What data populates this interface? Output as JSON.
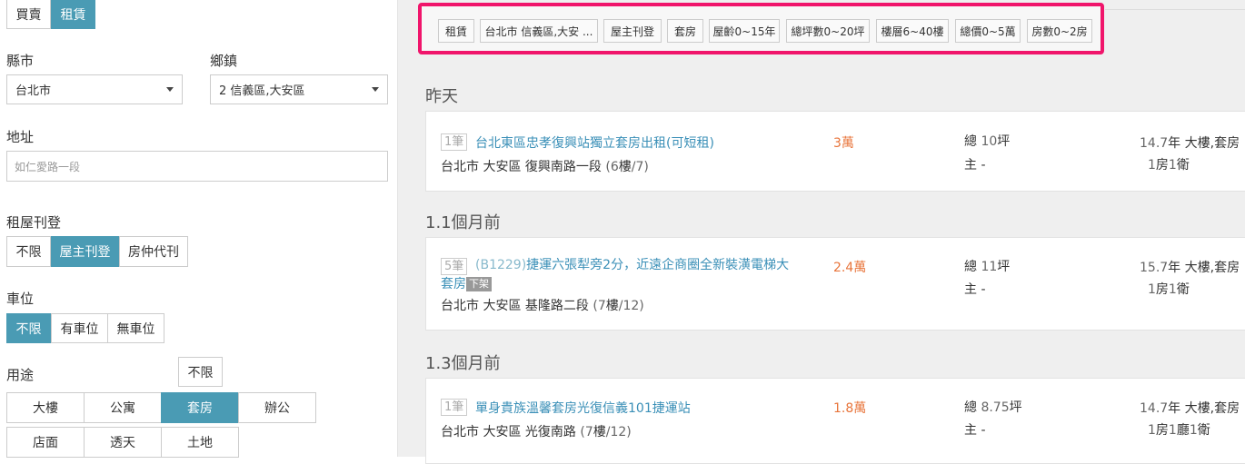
{
  "mode_tabs": [
    "買賣",
    "租賃"
  ],
  "labels": {
    "county": "縣市",
    "township": "鄉鎮",
    "address": "地址",
    "posting": "租屋刊登",
    "parking": "車位",
    "usage": "用途"
  },
  "county_select": "台北市",
  "township_select": "2 信義區,大安區",
  "address_placeholder": "如仁愛路一段",
  "posting_options": [
    "不限",
    "屋主刊登",
    "房仲代刊"
  ],
  "parking_options": [
    "不限",
    "有車位",
    "無車位"
  ],
  "usage_any": "不限",
  "usage_row1": [
    "大樓",
    "公寓",
    "套房",
    "辦公"
  ],
  "usage_row2": [
    "店面",
    "透天",
    "土地"
  ],
  "filters": [
    "租賃",
    "台北市 信義區,大安 ...",
    "屋主刊登",
    "套房",
    "屋齡0~15年",
    "總坪數0~20坪",
    "樓層6~40樓",
    "總價0~5萬",
    "房數0~2房"
  ],
  "groups": [
    {
      "section": "昨天",
      "count": "1筆",
      "title": "台北東區忠孝復興站獨立套房出租(可短租)",
      "price_num": "3",
      "price_unit": "萬",
      "city": "台北市",
      "district": "大安區",
      "road": "復興南路一段",
      "floor": "6",
      "floors_total": "7",
      "area_num": "10",
      "owner": "主 -",
      "age_num": "14.7",
      "age_unit": "年",
      "type": "大樓,套房",
      "layout_num1": "1",
      "layout_unit1": "房",
      "layout_num2": "1",
      "layout_unit2": "衛"
    },
    {
      "section": "1.1個月前",
      "count": "5筆",
      "title_prefix": "(B1229)",
      "title": "捷運六張犁旁2分，近遠企商圈全新裝潢電梯大",
      "title_line2": "套房",
      "tag": "下架",
      "price_num": "2.4",
      "price_unit": "萬",
      "city": "台北市",
      "district": "大安區",
      "road": "基隆路二段",
      "floor": "7",
      "floors_total": "12",
      "area_num": "11",
      "owner": "主 -",
      "age_num": "15.7",
      "age_unit": "年",
      "type": "大樓,套房",
      "layout_num1": "1",
      "layout_unit1": "房",
      "layout_num2": "1",
      "layout_unit2": "衛"
    },
    {
      "section": "1.3個月前",
      "count": "1筆",
      "title": "單身貴族溫馨套房光復信義101捷運站",
      "price_num": "1.8",
      "price_unit": "萬",
      "city": "台北市",
      "district": "大安區",
      "road": "光復南路",
      "floor": "7",
      "floors_total": "12",
      "area_num": "8.75",
      "owner": "主 -",
      "age_num": "14.7",
      "age_unit": "年",
      "type": "大樓,套房",
      "layout_num1": "1",
      "layout_unit1": "房",
      "layout_num2": "1",
      "layout_unit2": "廳",
      "layout_num3": "1",
      "layout_unit3": "衛"
    }
  ],
  "units": {
    "floor": "樓",
    "area_prefix": "總",
    "area_unit": "坪"
  },
  "colors": {
    "accent": "#4a9bb4",
    "highlight": "#f0156b",
    "price": "#e8743a",
    "link": "#3a8fb7"
  }
}
